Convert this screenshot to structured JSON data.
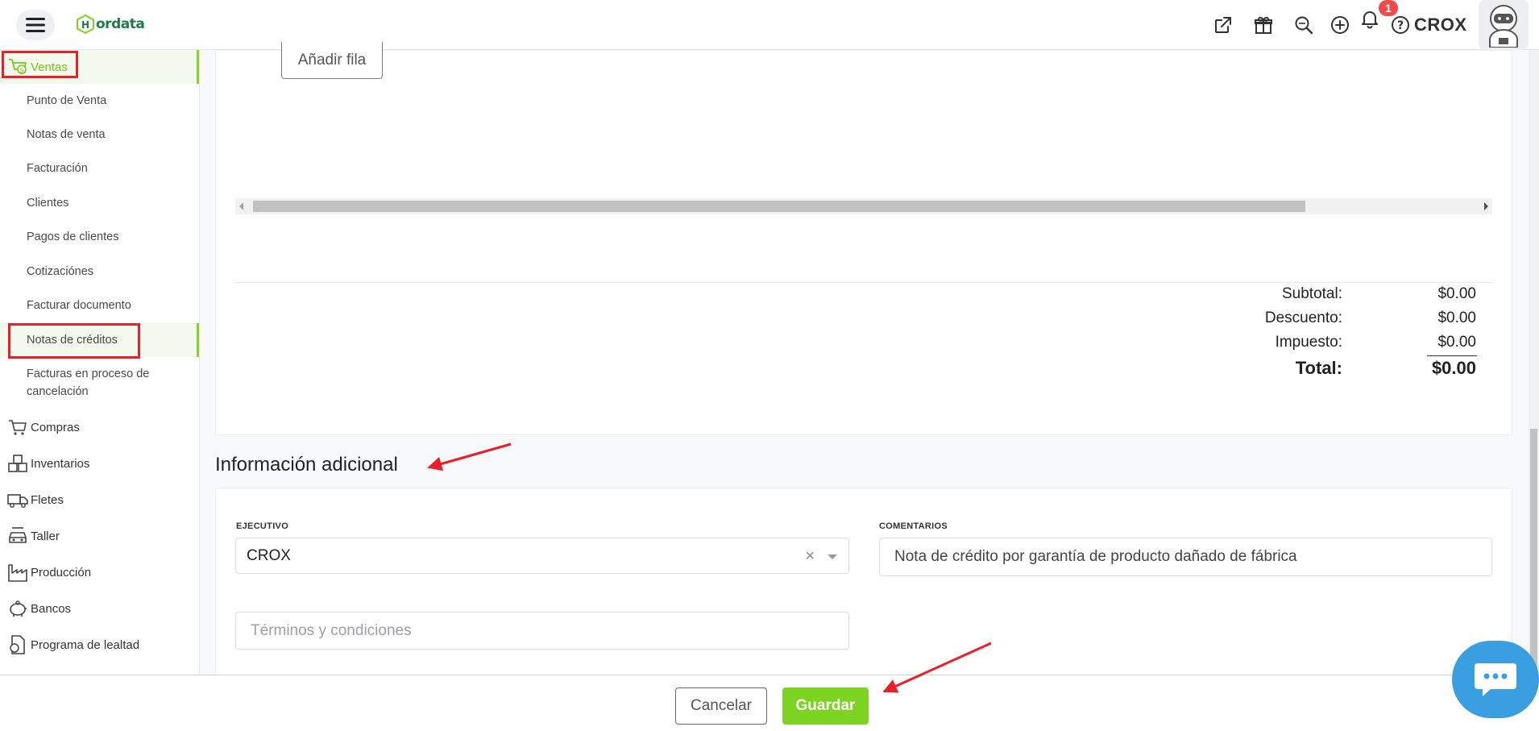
{
  "header": {
    "logo_text": "ordata",
    "user_name": "CROX",
    "notification_count": "1"
  },
  "sidebar": {
    "ventas_label": "Ventas",
    "ventas_items": [
      "Punto de Venta",
      "Notas de venta",
      "Facturación",
      "Clientes",
      "Pagos de clientes",
      "Cotizaciónes",
      "Facturar documento",
      "Notas de créditos"
    ],
    "facturas_cancel_1": "Facturas en proceso de",
    "facturas_cancel_2": "cancelación",
    "sections": [
      "Compras",
      "Inventarios",
      "Fletes",
      "Taller",
      "Producción",
      "Bancos",
      "Programa de lealtad"
    ]
  },
  "main": {
    "add_row_label": "Añadir fila",
    "totals": {
      "subtotal_label": "Subtotal:",
      "subtotal_value": "$0.00",
      "descuento_label": "Descuento:",
      "descuento_value": "$0.00",
      "impuesto_label": "Impuesto:",
      "impuesto_value": "$0.00",
      "total_label": "Total:",
      "total_value": "$0.00"
    },
    "section_title": "Información adicional",
    "ejecutivo_label": "EJECUTIVO",
    "ejecutivo_value": "CROX",
    "comentarios_label": "COMENTARIOS",
    "comentarios_value": "Nota de crédito por garantía de producto dañado de fábrica",
    "terminos_placeholder": "Términos y condiciones"
  },
  "footer": {
    "cancel_label": "Cancelar",
    "save_label": "Guardar"
  },
  "colors": {
    "accent_green": "#7cd321",
    "annotation_red": "#e8202a",
    "chat_blue": "#3a9fe0"
  }
}
